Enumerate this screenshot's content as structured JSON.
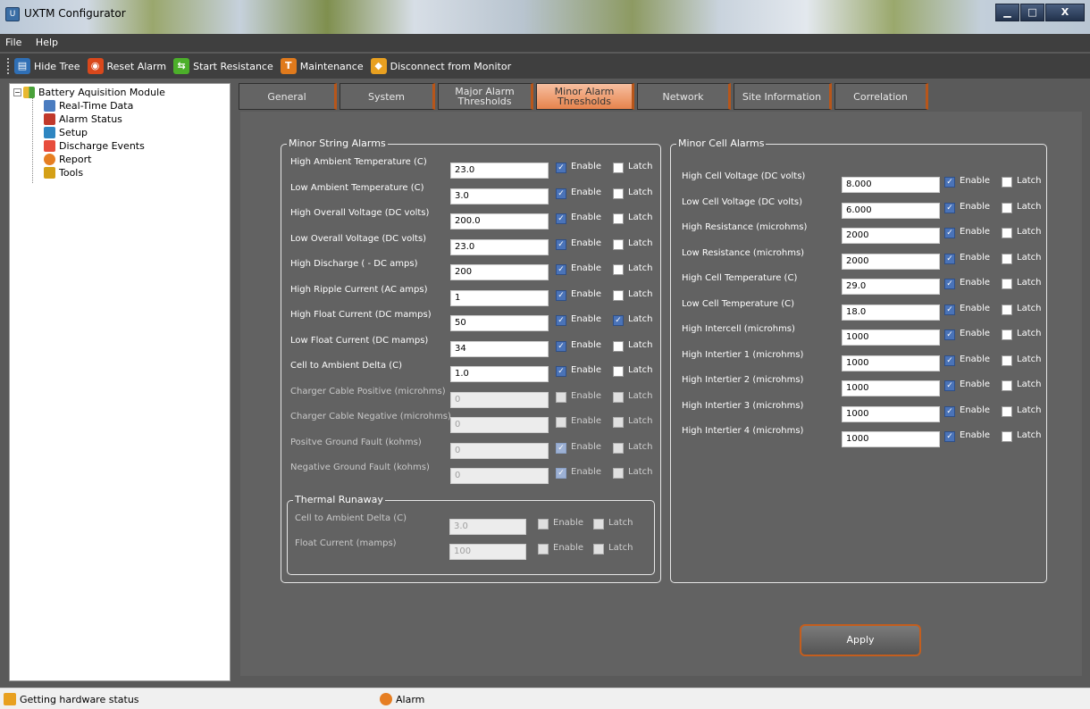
{
  "window": {
    "title": "UXTM Configurator",
    "min": "▁",
    "max": "□",
    "close": "X"
  },
  "menu": [
    "File",
    "Help"
  ],
  "toolbar": [
    {
      "label": "Hide Tree",
      "icon": "hide-tree-icon",
      "color": "#2f6fb5"
    },
    {
      "label": "Reset Alarm",
      "icon": "reset-alarm-icon",
      "color": "#d9481c"
    },
    {
      "label": "Start Resistance",
      "icon": "start-resistance-icon",
      "color": "#4caf2a"
    },
    {
      "label": "Maintenance",
      "icon": "maintenance-icon",
      "color": "#e07a1c"
    },
    {
      "label": "Disconnect from Monitor",
      "icon": "disconnect-icon",
      "color": "#e8a020"
    }
  ],
  "tree": {
    "root": "Battery Aquisition Module",
    "items": [
      "Real-Time Data",
      "Alarm Status",
      "Setup",
      "Discharge Events",
      "Report",
      "Tools"
    ]
  },
  "tabs": [
    "General",
    "System",
    "Major Alarm\nThresholds",
    "Minor Alarm\nThresholds",
    "Network",
    "Site Information",
    "Correlation"
  ],
  "active_tab": 3,
  "enable_label": "Enable",
  "latch_label": "Latch",
  "minor_string": {
    "title": "Minor String Alarms",
    "rows": [
      {
        "label": "High Ambient Temperature (C)",
        "value": "23.0",
        "enabled": true,
        "enable": true,
        "latch": false
      },
      {
        "label": "Low Ambient Temperature (C)",
        "value": "3.0",
        "enabled": true,
        "enable": true,
        "latch": false
      },
      {
        "label": "High Overall Voltage (DC volts)",
        "value": "200.0",
        "enabled": true,
        "enable": true,
        "latch": false
      },
      {
        "label": "Low Overall Voltage (DC volts)",
        "value": "23.0",
        "enabled": true,
        "enable": true,
        "latch": false
      },
      {
        "label": "High Discharge ( - DC amps)",
        "value": "200",
        "enabled": true,
        "enable": true,
        "latch": false
      },
      {
        "label": "High Ripple Current (AC amps)",
        "value": "1",
        "enabled": true,
        "enable": true,
        "latch": false
      },
      {
        "label": "High Float Current (DC mamps)",
        "value": "50",
        "enabled": true,
        "enable": true,
        "latch": true
      },
      {
        "label": "Low Float Current (DC mamps)",
        "value": "34",
        "enabled": true,
        "enable": true,
        "latch": false
      },
      {
        "label": "Cell to Ambient Delta (C)",
        "value": "1.0",
        "enabled": true,
        "enable": true,
        "latch": false
      },
      {
        "label": "Charger Cable Positive (microhms)",
        "value": "0",
        "enabled": false,
        "enable": false,
        "latch": false
      },
      {
        "label": "Charger Cable Negative (microhms)",
        "value": "0",
        "enabled": false,
        "enable": false,
        "latch": false
      },
      {
        "label": "Positve Ground Fault (kohms)",
        "value": "0",
        "enabled": false,
        "enable": true,
        "latch": false
      },
      {
        "label": "Negative Ground Fault (kohms)",
        "value": "0",
        "enabled": false,
        "enable": true,
        "latch": false
      }
    ]
  },
  "thermal": {
    "title": "Thermal Runaway",
    "rows": [
      {
        "label": "Cell to Ambient Delta (C)",
        "value": "3.0",
        "enabled": false,
        "enable": false,
        "latch": false
      },
      {
        "label": "Float Current (mamps)",
        "value": "100",
        "enabled": false,
        "enable": false,
        "latch": false
      }
    ]
  },
  "minor_cell": {
    "title": "Minor Cell Alarms",
    "rows": [
      {
        "label": "High Cell Voltage (DC volts)",
        "value": "8.000",
        "enabled": true,
        "enable": true,
        "latch": false
      },
      {
        "label": "Low Cell Voltage (DC volts)",
        "value": "6.000",
        "enabled": true,
        "enable": true,
        "latch": false
      },
      {
        "label": "High Resistance (microhms)",
        "value": "2000",
        "enabled": true,
        "enable": true,
        "latch": false
      },
      {
        "label": "Low Resistance (microhms)",
        "value": "2000",
        "enabled": true,
        "enable": true,
        "latch": false
      },
      {
        "label": "High Cell Temperature (C)",
        "value": "29.0",
        "enabled": true,
        "enable": true,
        "latch": false
      },
      {
        "label": "Low Cell Temperature (C)",
        "value": "18.0",
        "enabled": true,
        "enable": true,
        "latch": false
      },
      {
        "label": "High Intercell (microhms)",
        "value": "1000",
        "enabled": true,
        "enable": true,
        "latch": false
      },
      {
        "label": "High Intertier 1 (microhms)",
        "value": "1000",
        "enabled": true,
        "enable": true,
        "latch": false
      },
      {
        "label": "High Intertier 2 (microhms)",
        "value": "1000",
        "enabled": true,
        "enable": true,
        "latch": false
      },
      {
        "label": "High Intertier 3 (microhms)",
        "value": "1000",
        "enabled": true,
        "enable": true,
        "latch": false
      },
      {
        "label": "High Intertier 4 (microhms)",
        "value": "1000",
        "enabled": true,
        "enable": true,
        "latch": false
      }
    ]
  },
  "apply_label": "Apply",
  "status": {
    "left": "Getting hardware status",
    "alarm": "Alarm"
  }
}
